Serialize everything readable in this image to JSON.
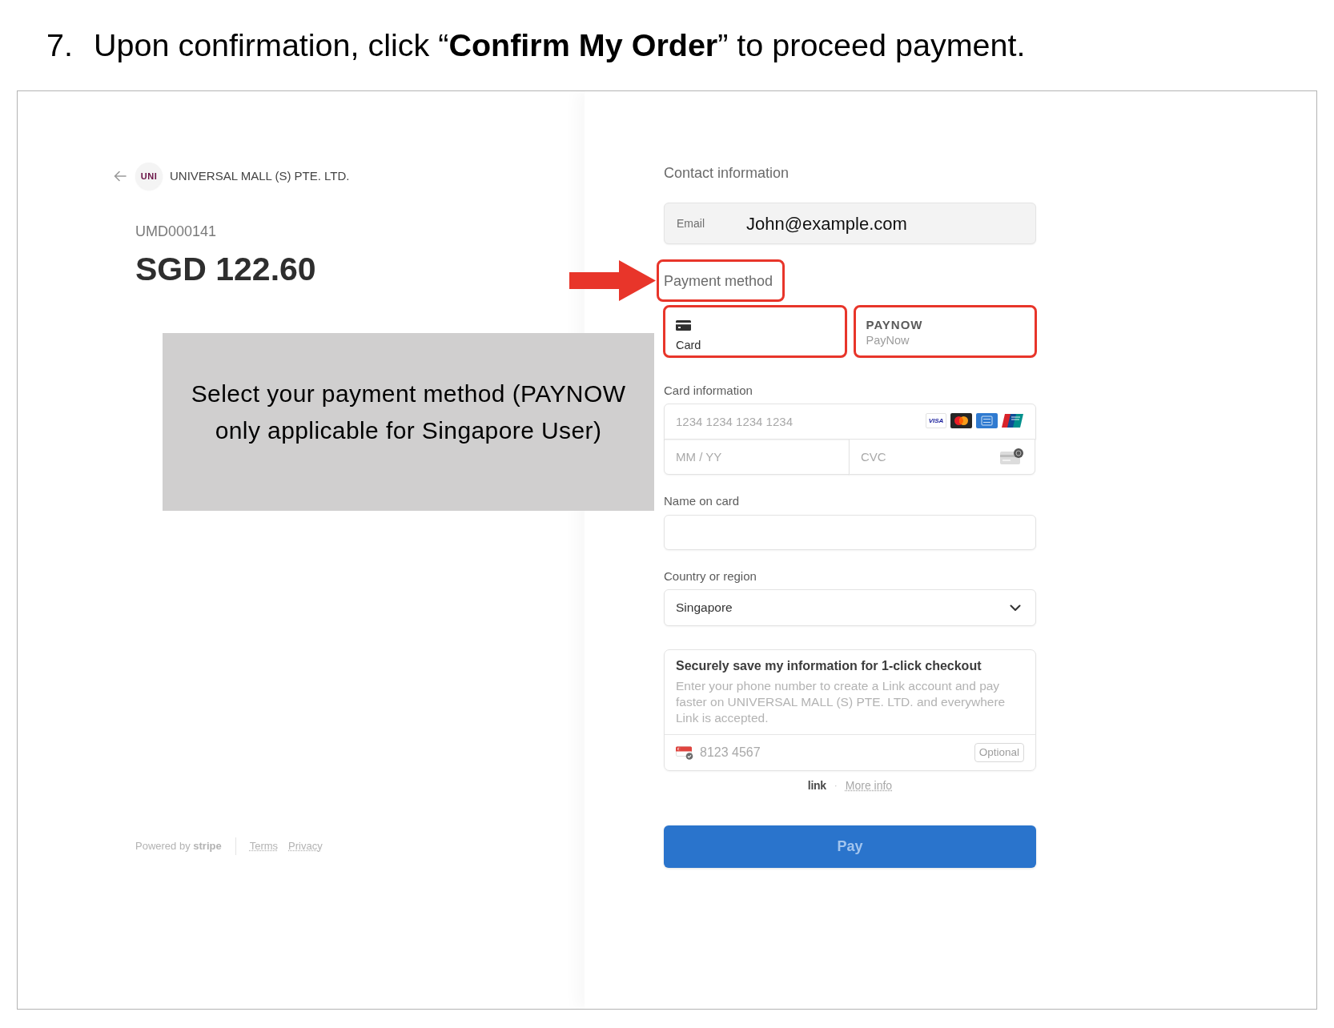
{
  "instruction": {
    "number": "7.",
    "text": "Upon confirmation, click “**Confirm My Order**” to proceed payment."
  },
  "merchant": {
    "logo_text": "UNI",
    "name": "UNIVERSAL MALL (S) PTE. LTD."
  },
  "order": {
    "reference": "UMD000141",
    "amount": "SGD 122.60"
  },
  "callout": {
    "text": "Select your payment method (PAYNOW only applicable for Singapore User)"
  },
  "footer": {
    "powered_by": "Powered by **stripe**",
    "links": [
      "Terms",
      "Privacy"
    ]
  },
  "contact": {
    "heading": "Contact information",
    "email": {
      "label": "Email",
      "value": "John@example.com"
    }
  },
  "payment": {
    "heading": "Payment method",
    "highlighted": true,
    "methods": [
      {
        "kind": "card",
        "label": "Card",
        "selected": true,
        "highlighted": true
      },
      {
        "kind": "paynow",
        "logo_text": "PAYNOW",
        "label": "PayNow",
        "selected": false,
        "highlighted": true
      }
    ]
  },
  "card_information": {
    "label": "Card information",
    "number_placeholder": "1234 1234 1234 1234",
    "brands": [
      {
        "kind": "visa",
        "text": "VISA"
      },
      {
        "kind": "mastercard"
      },
      {
        "kind": "amex"
      },
      {
        "kind": "unionpay"
      }
    ],
    "expiry_placeholder": "MM / YY",
    "cvc_placeholder": "CVC"
  },
  "name_on_card": {
    "label": "Name on card"
  },
  "country": {
    "label": "Country or region",
    "value": "Singapore"
  },
  "save_info": {
    "title": "Securely save my information for 1-click checkout",
    "description": "Enter your phone number to create a Link account and pay faster on UNIVERSAL MALL (S) PTE. LTD. and everywhere Link is accepted.",
    "phone_placeholder": "8123 4567",
    "optional": "Optional"
  },
  "link_footer": {
    "brand": "link",
    "separator": "·",
    "more_info": "More info"
  },
  "pay_button": {
    "label": "Pay",
    "disabled": true
  }
}
